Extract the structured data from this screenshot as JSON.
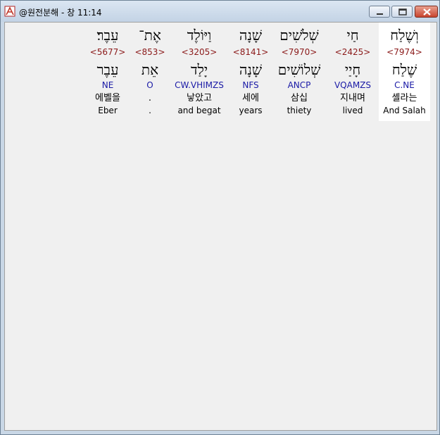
{
  "window": {
    "title": "@원전분해 - 창 11:14",
    "colors": {
      "strong": "#8b1a1a",
      "morph": "#1a1aa6",
      "selected_bg": "#ffffff",
      "client_bg": "#f0f0f0"
    },
    "icons": [
      "app-icon",
      "minimize-icon",
      "maximize-icon",
      "close-icon"
    ]
  },
  "words": [
    {
      "hebrew": "וְשֶׁלַח",
      "strong": "<7974>",
      "lemma": "שֶׁלַח",
      "morph": "C.NE",
      "korean": "셸라는",
      "english": "And Salah",
      "selected": true
    },
    {
      "hebrew": "חַי",
      "strong": "<2425>",
      "lemma": "חָיַי",
      "morph": "VQAMZS",
      "korean": "지내며",
      "english": "lived",
      "selected": false
    },
    {
      "hebrew": "שְׁלֹשִׁים",
      "strong": "<7970>",
      "lemma": "שְׁלוֹשִׁים",
      "morph": "ANCP",
      "korean": "삼십",
      "english": "thiety",
      "selected": false
    },
    {
      "hebrew": "שָׁנָה",
      "strong": "<8141>",
      "lemma": "שָׁנָה",
      "morph": "NFS",
      "korean": "세에",
      "english": "years",
      "selected": false
    },
    {
      "hebrew": "וַיּוֹלֶד",
      "strong": "<3205>",
      "lemma": "יָלַד",
      "morph": "CW.VHIMZS",
      "korean": "낳았고",
      "english": "and begat",
      "selected": false
    },
    {
      "hebrew": "אֶת־",
      "strong": "<853>",
      "lemma": "אֵת",
      "morph": "O",
      "korean": ".",
      "english": ".",
      "selected": false
    },
    {
      "hebrew": "עֵבֶר׃",
      "strong": "<5677>",
      "lemma": "עֵבֶר",
      "morph": "NE",
      "korean": "에벨을",
      "english": "Eber",
      "selected": false
    }
  ]
}
